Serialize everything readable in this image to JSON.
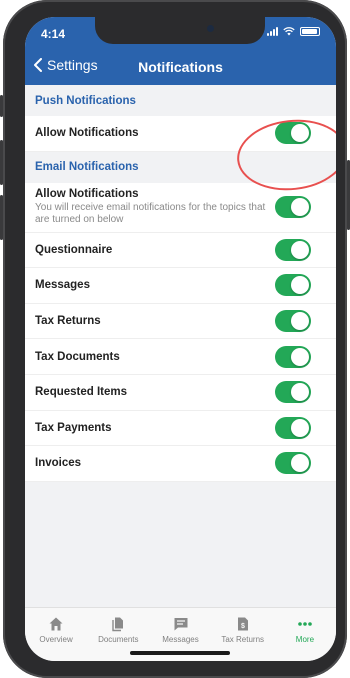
{
  "status": {
    "time": "4:14"
  },
  "nav": {
    "back_label": "Settings",
    "title": "Notifications"
  },
  "push": {
    "header": "Push Notifications",
    "allow_label": "Allow Notifications",
    "allow_on": true
  },
  "email": {
    "header": "Email Notifications",
    "allow_label": "Allow Notifications",
    "allow_sub": "You will receive email notifications for the topics that are turned on below",
    "items": [
      {
        "label": "Questionnaire",
        "on": true
      },
      {
        "label": "Messages",
        "on": true
      },
      {
        "label": "Tax Returns",
        "on": true
      },
      {
        "label": "Tax Documents",
        "on": true
      },
      {
        "label": "Requested Items",
        "on": true
      },
      {
        "label": "Tax Payments",
        "on": true
      },
      {
        "label": "Invoices",
        "on": true
      }
    ]
  },
  "tabs": [
    {
      "label": "Overview",
      "icon": "home-icon"
    },
    {
      "label": "Documents",
      "icon": "documents-icon"
    },
    {
      "label": "Messages",
      "icon": "message-icon"
    },
    {
      "label": "Tax Returns",
      "icon": "tax-return-icon"
    },
    {
      "label": "More",
      "icon": "more-icon",
      "active": true
    }
  ],
  "colors": {
    "accent": "#2a63ad",
    "toggle_on": "#23a857",
    "highlight": "#e8504f"
  }
}
